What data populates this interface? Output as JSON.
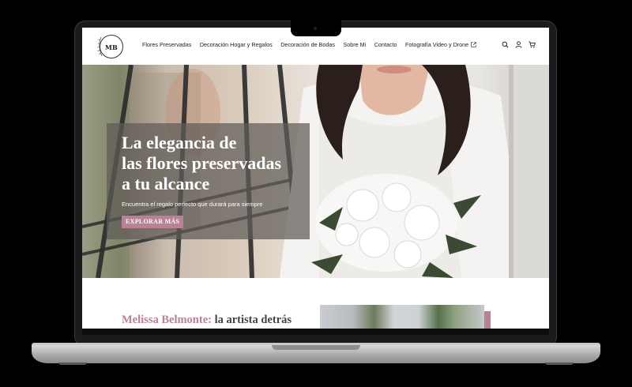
{
  "header": {
    "logo_text": "MB",
    "nav": [
      {
        "label": "Flores Preservadas"
      },
      {
        "label": "Decoración Hogar y Regalos"
      },
      {
        "label": "Decoración de Bodas"
      },
      {
        "label": "Sobre Mi"
      },
      {
        "label": "Contacto"
      },
      {
        "label": "Fotografía Video y Drone",
        "external": true
      }
    ],
    "icons": [
      "search-icon",
      "user-icon",
      "cart-icon"
    ]
  },
  "hero": {
    "title_lines": [
      "La elegancia de",
      "las flores preservadas",
      "a tu alcance"
    ],
    "subtitle": "Encuentra el regalo perfecto que durará para siempre",
    "button_label": "EXPLORAR MÁS"
  },
  "about": {
    "title_accent": "Melissa Belmonte:",
    "title_rest": " la artista detrás"
  },
  "colors": {
    "accent": "#b98195",
    "overlay": "#5f5c58",
    "text": "#222222"
  }
}
